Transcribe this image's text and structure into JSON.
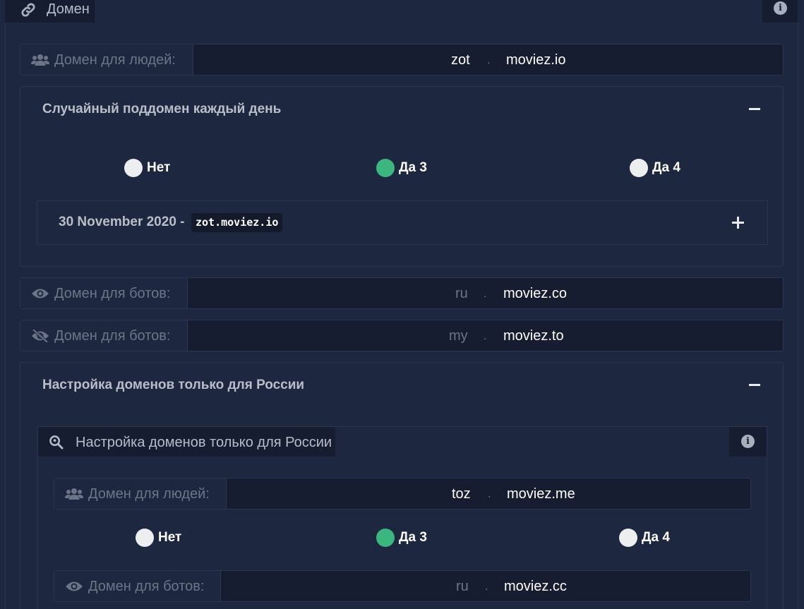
{
  "panel": {
    "title": "Домен",
    "icon": "link-icon",
    "info_icon": "info-icon"
  },
  "human_domain": {
    "label": "Домен для людей:",
    "icon": "users-icon",
    "subdomain": "zot",
    "separator": ".",
    "domain": "moviez.io"
  },
  "random_subdomain": {
    "title": "Случайный поддомен каждый день",
    "collapse_symbol": "−",
    "options": [
      "Нет",
      "Да 3",
      "Да 4"
    ],
    "selected": "Да 3",
    "date_row": {
      "date": "30 November 2020 -",
      "code": "zot.moviez.io"
    }
  },
  "bot_domain_1": {
    "label": "Домен для ботов:",
    "icon": "eye-icon",
    "subdomain": "ru",
    "separator": ".",
    "domain": "moviez.co"
  },
  "bot_domain_2": {
    "label": "Домен для ботов:",
    "icon": "eye-slash-icon",
    "subdomain": "my",
    "separator": ".",
    "domain": "moviez.to"
  },
  "russia": {
    "title": "Настройка доменов только для России",
    "inner_title": "Настройка доменов только для России",
    "inner_icon": "search-location-icon",
    "human_domain": {
      "label": "Домен для людей:",
      "subdomain": "toz",
      "separator": ".",
      "domain": "moviez.me"
    },
    "options": [
      "Нет",
      "Да 3",
      "Да 4"
    ],
    "selected": "Да 3",
    "bot_domain": {
      "label": "Домен для ботов:",
      "subdomain": "ru",
      "separator": ".",
      "domain": "moviez.cc"
    }
  },
  "colors": {
    "background": "#1e2740",
    "input_bg": "#161d30",
    "accent_green": "#3cb67f",
    "muted_text": "#6c7588"
  }
}
